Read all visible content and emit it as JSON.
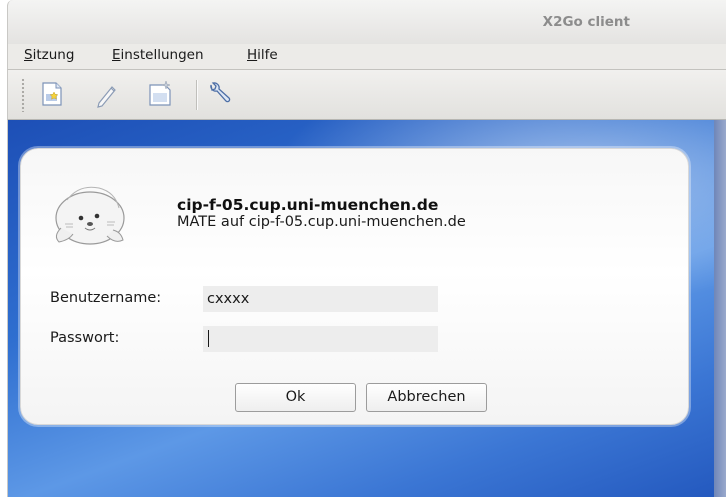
{
  "window": {
    "title": "X2Go client"
  },
  "menubar": {
    "items": [
      {
        "label": "Sitzung",
        "mnemonic": "S",
        "rest": "itzung"
      },
      {
        "label": "Einstellungen",
        "mnemonic": "E",
        "rest": "instellungen"
      },
      {
        "label": "Hilfe",
        "mnemonic": "H",
        "rest": "ilfe"
      }
    ]
  },
  "toolbar": {
    "icons": [
      "new-session-icon",
      "edit-session-icon",
      "session-export-icon",
      "wrench-settings-icon"
    ]
  },
  "login": {
    "server_name": "cip-f-05.cup.uni-muenchen.de",
    "session_info": "MATE auf cip-f-05.cup.uni-muenchen.de",
    "username_label": "Benutzername:",
    "username_value": "cxxxx",
    "password_label": "Passwort:",
    "password_value": "",
    "ok_label": "Ok",
    "cancel_label": "Abbrechen"
  },
  "colors": {
    "desktop_blue": "#2f6fd0",
    "field_bg": "#ededed",
    "title_text": "#8c8c8c"
  }
}
